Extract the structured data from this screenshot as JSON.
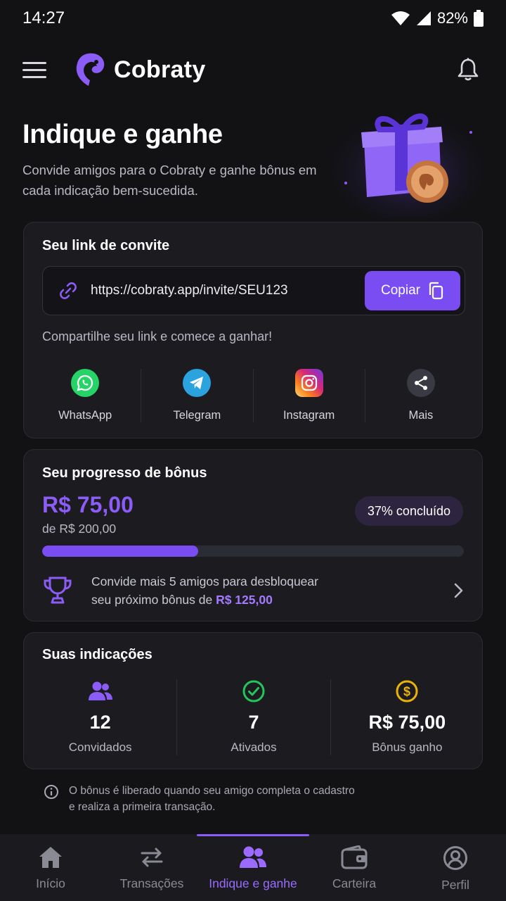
{
  "status_bar": {
    "time": "14:27",
    "battery": "82%"
  },
  "header": {
    "brand": "Cobraty",
    "menu_icon": "hamburger-icon",
    "bell_icon": "bell-icon"
  },
  "hero": {
    "title": "Indique e ganhe",
    "subtitle": "Convide amigos para o Cobraty e ganhe bônus em cada indicação bem-sucedida."
  },
  "invite": {
    "title": "Seu link de convite",
    "link": "https://cobraty.app/invite/SEU123",
    "copy_label": "Copiar",
    "hint": "Compartilhe seu link e comece a ganhar!",
    "share": [
      {
        "label": "WhatsApp",
        "icon": "whatsapp-icon",
        "color": "#25d366"
      },
      {
        "label": "Telegram",
        "icon": "telegram-icon",
        "color": "#2aa3df"
      },
      {
        "label": "Instagram",
        "icon": "instagram-icon",
        "color": "#d62976"
      },
      {
        "label": "Mais",
        "icon": "share-icon",
        "color": "#3a3a42"
      }
    ]
  },
  "progress": {
    "title": "Seu progresso de bônus",
    "amount": "R$ 75,00",
    "of_amount": "de R$ 200,00",
    "percent_label": "37% concluído",
    "percent": 37,
    "goal_text_1": "Convide mais 5 amigos para desbloquear",
    "goal_text_2": "seu próximo bônus de",
    "goal_amount": "R$ 125,00"
  },
  "referrals": {
    "title": "Suas indicações",
    "stats": [
      {
        "value": "12",
        "label": "Convidados",
        "icon": "users-icon"
      },
      {
        "value": "7",
        "label": "Ativados",
        "icon": "check-circle-icon"
      },
      {
        "value": "R$ 75,00",
        "label": "Bônus ganho",
        "icon": "dollar-coin-icon"
      }
    ]
  },
  "notice": {
    "text_1": "O bônus é liberado quando seu amigo completa o cadastro",
    "text_2": "e realiza a primeira transação."
  },
  "bottom_nav": [
    {
      "label": "Início",
      "icon": "home-icon",
      "active": false
    },
    {
      "label": "Transações",
      "icon": "transfer-icon",
      "active": false
    },
    {
      "label": "Indique e ganhe",
      "icon": "users-icon",
      "active": true
    },
    {
      "label": "Carteira",
      "icon": "wallet-icon",
      "active": false
    },
    {
      "label": "Perfil",
      "icon": "profile-icon",
      "active": false
    }
  ],
  "colors": {
    "accent": "#7a4df3",
    "background": "#121215",
    "card": "#1b1b20"
  }
}
